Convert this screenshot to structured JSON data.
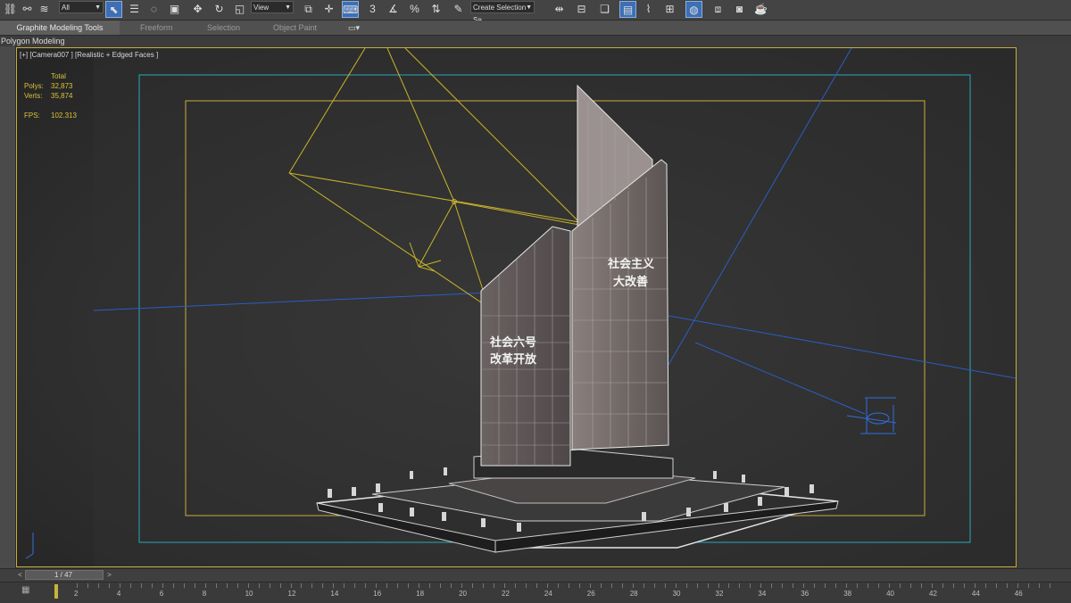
{
  "toolbar": {
    "selection_filter": "All",
    "reference_coord": "View",
    "named_selection_placeholder": "Create Selection Se",
    "angle_snap_label": "3",
    "percent_snap_label": "%"
  },
  "ribbon": {
    "tabs": [
      {
        "label": "Graphite Modeling Tools",
        "active": true
      },
      {
        "label": "Freeform",
        "active": false
      },
      {
        "label": "Selection",
        "active": false
      },
      {
        "label": "Object Paint",
        "active": false
      }
    ],
    "sub_label": "Polygon Modeling"
  },
  "viewport": {
    "label": "[+] [Camera007 ] [Realistic + Edged Faces ]",
    "stats": {
      "header": "Total",
      "polys_label": "Polys:",
      "polys_value": "32,873",
      "verts_label": "Verts:",
      "verts_value": "35,874",
      "fps_label": "FPS:",
      "fps_value": "102.313"
    },
    "monument_text_left": "社会主义",
    "monument_text_left2": "大改善",
    "monument_text_right": "社会六号",
    "monument_text_right2": "改革开放"
  },
  "timeline": {
    "frame_display": "1 / 47",
    "ticks": [
      "2",
      "4",
      "6",
      "8",
      "10",
      "12",
      "14",
      "16",
      "18",
      "20",
      "22",
      "24",
      "26",
      "28",
      "30",
      "32",
      "34",
      "36",
      "38",
      "40",
      "42",
      "44",
      "46"
    ]
  },
  "colors": {
    "viewport_border": "#c7ad3a",
    "safe_frame_outer": "#2aa7b8",
    "safe_frame_inner": "#c7ad3a",
    "camera_lines": "#c8b42a",
    "light_lines": "#2a5ec4",
    "active_button": "#3c6fb5"
  }
}
